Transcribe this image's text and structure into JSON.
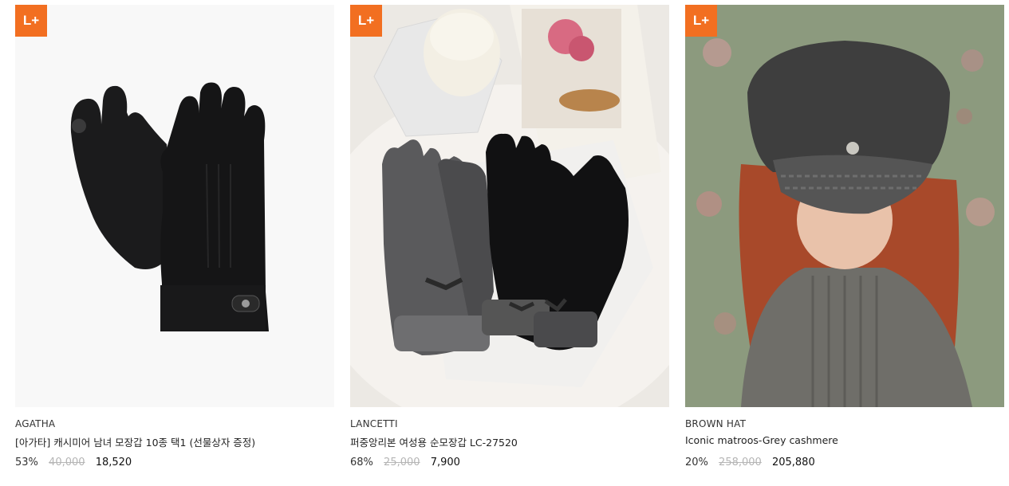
{
  "colors": {
    "badge": "#f26f21"
  },
  "products": [
    {
      "badge": "L+",
      "brand": "AGATHA",
      "name": "[아가타] 캐시미어 남녀 모장갑 10종 택1 (선물상자 증정)",
      "discount": "53%",
      "original_price": "40,000",
      "sale_price": "18,520",
      "image_icon": "black-gloves-image"
    },
    {
      "badge": "L+",
      "brand": "LANCETTI",
      "name": "퍼중앙리본 여성용 순모장갑 LC-27520",
      "discount": "68%",
      "original_price": "25,000",
      "sale_price": "7,900",
      "image_icon": "grey-black-gloves-image"
    },
    {
      "badge": "L+",
      "brand": "BROWN HAT",
      "name": "Iconic matroos-Grey cashmere",
      "discount": "20%",
      "original_price": "258,000",
      "sale_price": "205,880",
      "image_icon": "grey-cap-model-image"
    }
  ]
}
